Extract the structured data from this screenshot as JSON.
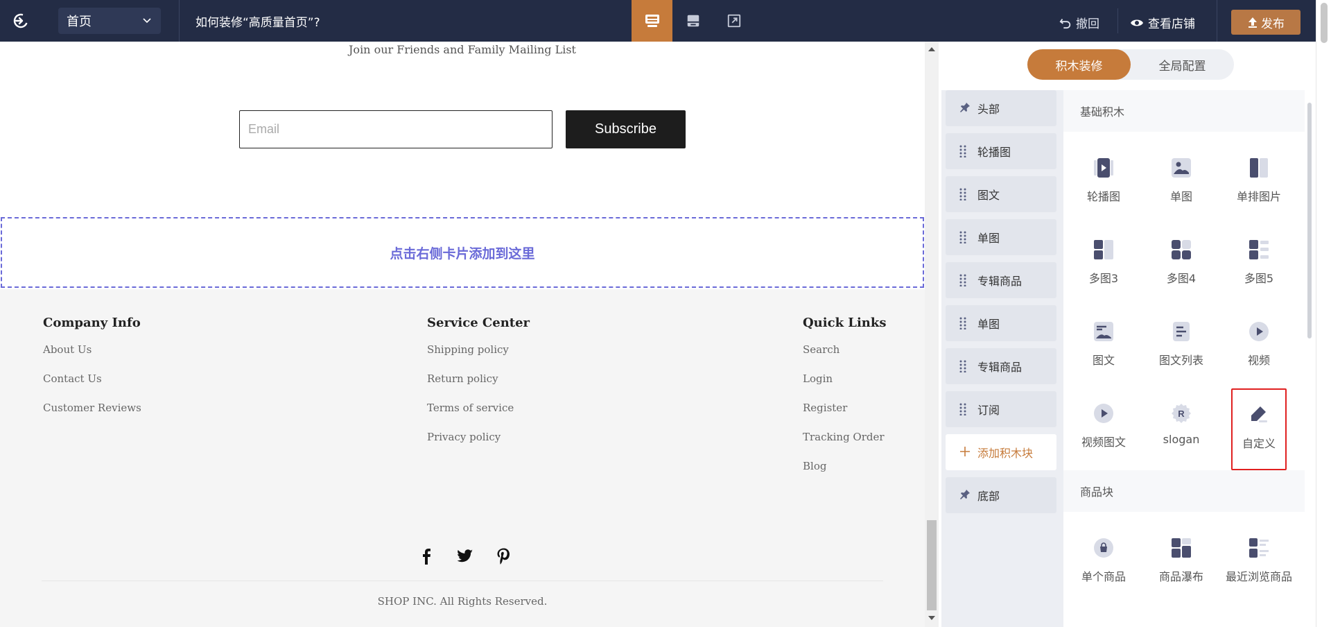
{
  "topbar": {
    "page_select": "首页",
    "help_link": "如何装修“高质量首页”?",
    "undo_label": "撤回",
    "view_store_label": "查看店铺",
    "publish_label": "发布",
    "view_modes": [
      "desktop",
      "tablet",
      "fullscreen"
    ],
    "active_view": "desktop"
  },
  "canvas": {
    "mailing_text": "Join our Friends and Family Mailing List",
    "email_placeholder": "Email",
    "subscribe_label": "Subscribe",
    "drop_zone_text": "点击右侧卡片添加到这里",
    "footer": {
      "columns": [
        {
          "title": "Company Info",
          "links": [
            "About Us",
            "Contact Us",
            "Customer Reviews"
          ]
        },
        {
          "title": "Service Center",
          "links": [
            "Shipping policy",
            "Return policy",
            "Terms of service",
            "Privacy policy"
          ]
        },
        {
          "title": "Quick Links",
          "links": [
            "Search",
            "Login",
            "Register",
            "Tracking Order",
            "Blog"
          ]
        }
      ],
      "socials": [
        "facebook-icon",
        "twitter-icon",
        "pinterest-icon"
      ],
      "copyright": "SHOP INC. All Rights Reserved."
    }
  },
  "panel": {
    "tabs": [
      "积木装修",
      "全局配置"
    ],
    "active_tab": "积木装修",
    "blocks": [
      {
        "label": "头部",
        "icon": "pin-icon"
      },
      {
        "label": "轮播图",
        "icon": "drag-handle-icon"
      },
      {
        "label": "图文",
        "icon": "drag-handle-icon"
      },
      {
        "label": "单图",
        "icon": "drag-handle-icon"
      },
      {
        "label": "专辑商品",
        "icon": "drag-handle-icon"
      },
      {
        "label": "单图",
        "icon": "drag-handle-icon"
      },
      {
        "label": "专辑商品",
        "icon": "drag-handle-icon"
      },
      {
        "label": "订阅",
        "icon": "drag-handle-icon"
      },
      {
        "label": "添加积木块",
        "icon": "plus-icon"
      },
      {
        "label": "底部",
        "icon": "pin-icon"
      }
    ],
    "sections": [
      {
        "title": "基础积木",
        "items": [
          "轮播图",
          "单图",
          "单排图片",
          "多图3",
          "多图4",
          "多图5",
          "图文",
          "图文列表",
          "视频",
          "视频图文",
          "slogan",
          "自定义"
        ]
      },
      {
        "title": "商品块",
        "items": [
          "单个商品",
          "商品瀑布",
          "最近浏览商品"
        ]
      }
    ],
    "selected_item": "自定义"
  },
  "colors": {
    "topbar_bg": "#232c45",
    "accent": "#c67b3b",
    "dropzone": "#6a6ad8",
    "icon_dark": "#4a4e6e",
    "icon_light": "#d8dbe6",
    "selected_border": "#e02020"
  }
}
